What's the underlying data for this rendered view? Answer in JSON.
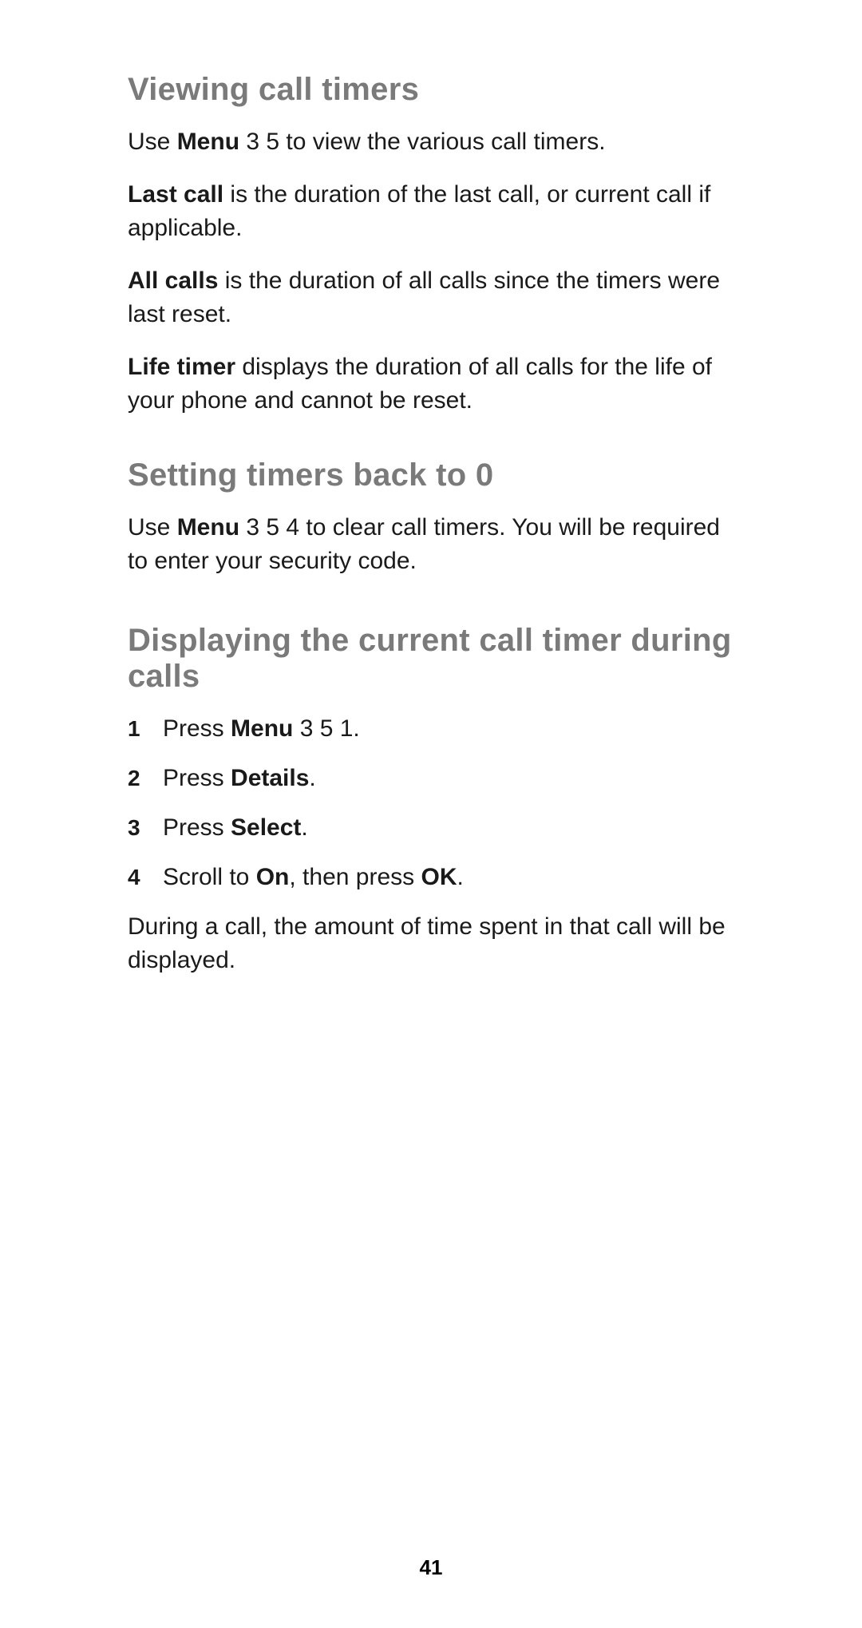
{
  "section1": {
    "heading": "Viewing call timers",
    "p1_a": "Use ",
    "p1_b": "Menu",
    "p1_c": " 3 5 to view the various call timers.",
    "p2_a": "Last call",
    "p2_b": " is the duration of the last call, or current call if applicable.",
    "p3_a": "All calls",
    "p3_b": " is the duration of all calls since the timers were last reset.",
    "p4_a": "Life timer",
    "p4_b": " displays the duration of all calls for the life of your phone and cannot be reset."
  },
  "section2": {
    "heading": "Setting timers back to 0",
    "p1_a": "Use ",
    "p1_b": "Menu",
    "p1_c": " 3 5 4 to clear call timers. You will be required to enter your security code."
  },
  "section3": {
    "heading": "Displaying the current call timer during calls",
    "step1_a": "Press ",
    "step1_b": "Menu",
    "step1_c": " 3 5 1.",
    "step2_a": "Press ",
    "step2_b": "Details",
    "step2_c": ".",
    "step3_a": "Press ",
    "step3_b": "Select",
    "step3_c": ".",
    "step4_a": "Scroll to ",
    "step4_b": "On",
    "step4_c": ", then press ",
    "step4_d": "OK",
    "step4_e": ".",
    "p_after": "During a call, the amount of time spent in that call will be displayed."
  },
  "page_number": "41"
}
